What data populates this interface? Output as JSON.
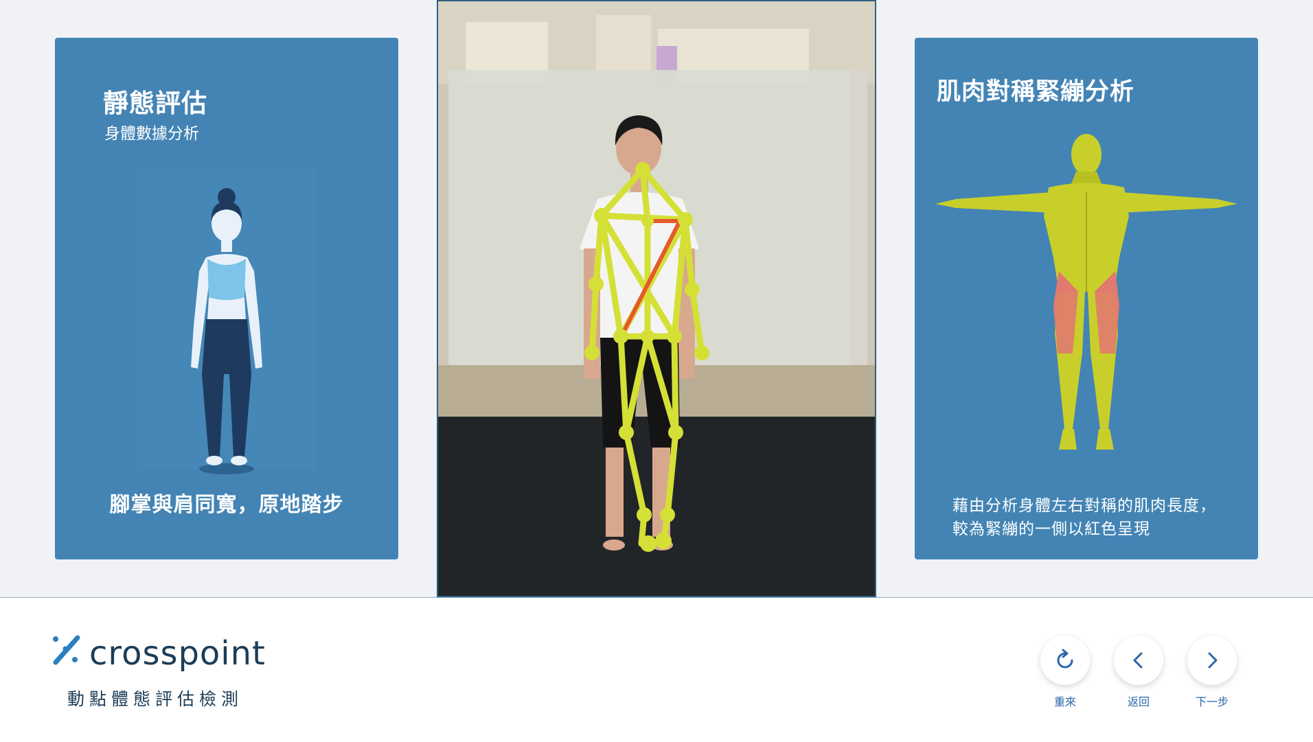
{
  "left_card": {
    "title": "靜態評估",
    "subtitle": "身體數據分析",
    "instruction": "腳掌與肩同寬，原地踏步"
  },
  "right_card": {
    "title": "肌肉對稱緊繃分析",
    "description": "藉由分析身體左右對稱的肌肉長度，較為緊繃的一側以紅色呈現"
  },
  "brand": {
    "name": "crosspoint",
    "tagline": "動點體態評估檢測"
  },
  "nav": {
    "replay_label": "重來",
    "back_label": "返回",
    "next_label": "下一步"
  },
  "colors": {
    "card_bg": "#4384b4",
    "skeleton": "#d4e036",
    "highlight": "#e55a2b",
    "brand_dark": "#1c3d57",
    "nav_text": "#2a66a8"
  },
  "icons": [
    "replay-icon",
    "chevron-left-icon",
    "chevron-right-icon",
    "crosspoint-logo-icon"
  ]
}
